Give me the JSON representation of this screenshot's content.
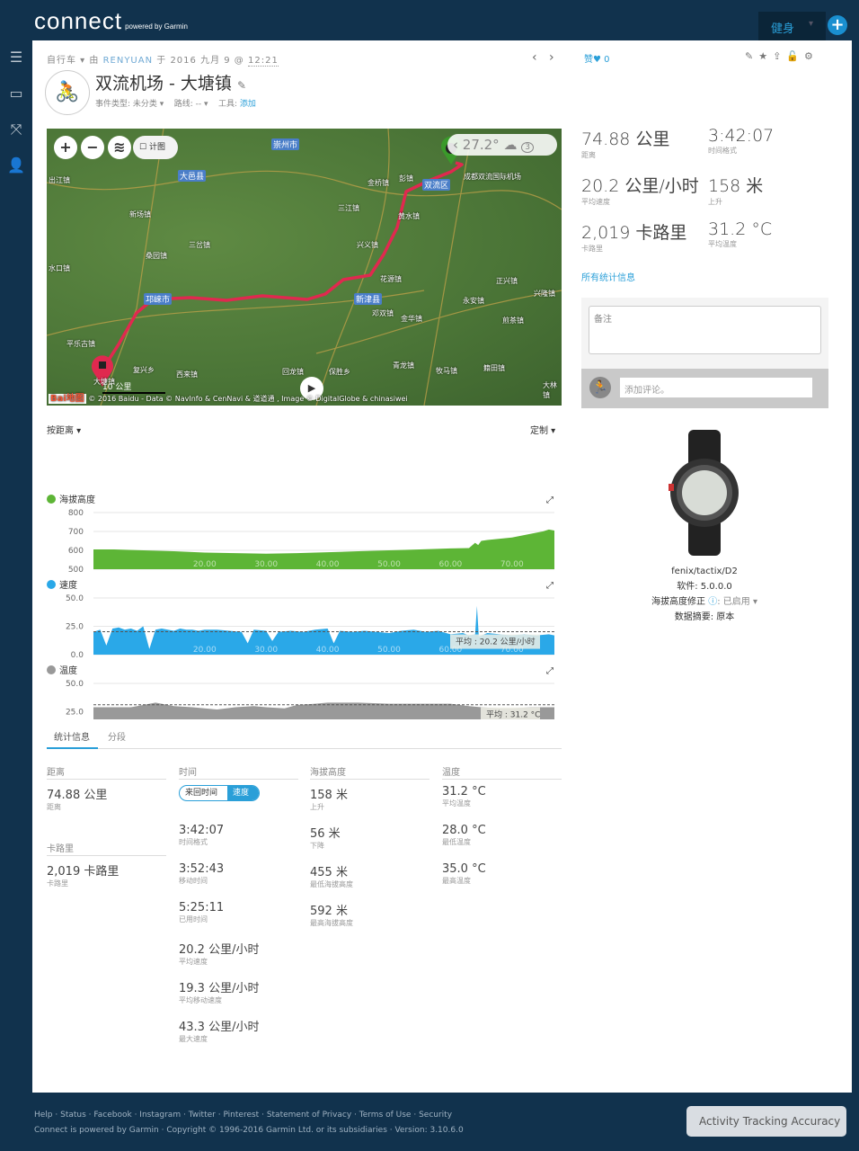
{
  "header": {
    "logo": "connect",
    "logo_sub": "powered by Garmin",
    "fitness_label": "健身",
    "menu_caret": "▾",
    "add_label": "+"
  },
  "sidebar": {
    "items": [
      {
        "icon": "menu-icon",
        "glyph": "☰"
      },
      {
        "icon": "inbox-icon",
        "glyph": "▭"
      },
      {
        "icon": "connections-icon",
        "glyph": "⤧"
      },
      {
        "icon": "user-icon",
        "glyph": "👤"
      }
    ]
  },
  "activity": {
    "type": "自行车",
    "by": "由",
    "user": "RENYUAN",
    "at": "于 2016 九月 9 @",
    "time": "12:21",
    "title": "双流机场 - 大塘镇",
    "event_type": "事件类型: 未分类 ▾",
    "route": "路线: -- ▾",
    "gear_label": "工具:",
    "gear_link": "添加",
    "like_label": "赞",
    "like_count": "0",
    "prev": "‹",
    "next": "›"
  },
  "map": {
    "zoom_in": "+",
    "zoom_out": "−",
    "layers": "≋",
    "checkbox_label": "计图",
    "weather_temp": "27.2°",
    "weather_badge": "3",
    "scale": "10 公里",
    "attribution": "© 2016 Baidu - Data © NavInfo & CenNavi & 道道通 , Image © DigitalGlobe & chinasiwei",
    "provider": "Bai地图",
    "cities": [
      "崇州市",
      "大邑县",
      "邛崃市",
      "新津县",
      "双流区"
    ],
    "towns": [
      "出江镇",
      "新场镇",
      "三岔镇",
      "桑园镇",
      "水口镇",
      "平乐古镇",
      "大塘镇",
      "复兴乡",
      "西来镇",
      "回龙镇",
      "保胜乡",
      "青龙镇",
      "牧马镇",
      "金桥镇",
      "彭镇",
      "三江镇",
      "黄水镇",
      "兴义镇",
      "花源镇",
      "邓双镇",
      "金华镇",
      "永安镇",
      "正兴镇",
      "兴隆镇",
      "煎茶镇",
      "籍田镇",
      "大林镇",
      "成都双流国际机场"
    ]
  },
  "summary": [
    {
      "value": "74.88 公里",
      "label": "距离"
    },
    {
      "value": "3:42:07",
      "label": "时间格式"
    },
    {
      "value": "20.2 公里/小时",
      "label": "平均速度"
    },
    {
      "value": "158 米",
      "label": "上升"
    },
    {
      "value": "2,019 卡路里",
      "label": "卡路里"
    },
    {
      "value": "31.2 °C",
      "label": "平均温度"
    }
  ],
  "all_stats_link": "所有统计信息",
  "notes": {
    "placeholder": "备注",
    "comment_placeholder": "添加评论。"
  },
  "device": {
    "name": "fenix/tactix/D2",
    "software": "软件: 5.0.0.0",
    "elev_corr_label": "海拔高度修正",
    "elev_corr_value": ": 已启用 ▾",
    "data_summary": "数据摘要: 原本"
  },
  "charts": {
    "x_mode": "按距离 ▾",
    "customize": "定制 ▾"
  },
  "chart_data": [
    {
      "type": "area",
      "name": "海拔高度",
      "color": "#5db536",
      "ylim": [
        500,
        800
      ],
      "yticks": [
        "800",
        "700",
        "600",
        "500"
      ],
      "xlim": [
        1.9,
        76.9
      ],
      "xticks": [
        "20.00",
        "30.00",
        "40.00",
        "50.00",
        "60.00",
        "70.00"
      ],
      "grid": true,
      "x": [
        1.9,
        5,
        10,
        15,
        20,
        25,
        30,
        35,
        40,
        45,
        50,
        55,
        60,
        63,
        64,
        64.5,
        65,
        66,
        70,
        75,
        76,
        76.9
      ],
      "y": [
        605,
        605,
        600,
        595,
        588,
        585,
        582,
        585,
        590,
        595,
        600,
        605,
        610,
        612,
        640,
        628,
        650,
        655,
        668,
        700,
        710,
        705
      ]
    },
    {
      "type": "area",
      "name": "速度",
      "color": "#2aa8e8",
      "ylim": [
        0,
        50
      ],
      "yticks": [
        "50.0",
        "25.0",
        "0.0"
      ],
      "xlim": [
        1.9,
        76.9
      ],
      "xticks": [
        "20.00",
        "30.00",
        "40.00",
        "50.00",
        "60.00",
        "70.00"
      ],
      "grid": true,
      "average": 20.2,
      "average_label": "平均 : 20.2 公里/小时",
      "x": [
        1.9,
        3,
        4,
        5,
        6,
        7,
        8,
        9,
        10,
        11,
        12,
        13,
        14,
        15,
        16,
        17,
        18,
        19,
        20,
        22,
        24,
        26,
        27,
        28,
        30,
        31,
        32,
        34,
        36,
        38,
        40,
        41,
        42,
        44,
        46,
        48,
        50,
        52,
        54,
        56,
        58,
        60,
        62,
        63,
        64,
        64.3,
        64.6,
        66,
        68,
        70,
        72,
        74,
        76,
        76.9
      ],
      "y": [
        20,
        22,
        8,
        23,
        24,
        22,
        23,
        21,
        25,
        5,
        22,
        23,
        22,
        21,
        23,
        22,
        22,
        21,
        22,
        22,
        21,
        20,
        10,
        22,
        21,
        12,
        20,
        21,
        20,
        22,
        23,
        10,
        21,
        20,
        21,
        20,
        19,
        21,
        22,
        20,
        21,
        18,
        19,
        17,
        18,
        43,
        16,
        19,
        18,
        17,
        18,
        17,
        18,
        17
      ]
    },
    {
      "type": "area",
      "name": "温度",
      "color": "#999999",
      "ylim": [
        0,
        50
      ],
      "yticks": [
        "50.0",
        "25.0",
        "0.0"
      ],
      "xlim": [
        1.9,
        76.9
      ],
      "xticks": [
        "20.00",
        "30.00",
        "40.00",
        "50.00",
        "60.00",
        "70.00"
      ],
      "grid": true,
      "average": 31.2,
      "average_label": "平均 : 31.2 °C",
      "x": [
        1.9,
        5,
        8,
        10,
        12,
        15,
        18,
        20,
        22,
        25,
        28,
        30,
        33,
        35,
        38,
        40,
        45,
        50,
        55,
        60,
        63,
        65,
        68,
        70,
        73,
        76.9
      ],
      "y": [
        29,
        29,
        29,
        31,
        33,
        30,
        29,
        28,
        27,
        29,
        30,
        29,
        28,
        31,
        32,
        33,
        33,
        32,
        32,
        32,
        30,
        29,
        28,
        28,
        29,
        29
      ]
    }
  ],
  "tabs": [
    {
      "label": "统计信息",
      "active": true
    },
    {
      "label": "分段",
      "active": false
    }
  ],
  "stats": {
    "distance": {
      "header": "距离",
      "items": [
        {
          "value": "74.88 公里",
          "label": "距离"
        }
      ]
    },
    "calories": {
      "header": "卡路里",
      "items": [
        {
          "value": "2,019 卡路里",
          "label": "卡路里"
        }
      ]
    },
    "time": {
      "header": "时间",
      "toggle": [
        "来回时间",
        "速度"
      ],
      "items": [
        {
          "value": "3:42:07",
          "label": "时间格式"
        },
        {
          "value": "3:52:43",
          "label": "移动时间"
        },
        {
          "value": "5:25:11",
          "label": "已用时间"
        },
        {
          "value": "20.2 公里/小时",
          "label": "平均速度"
        },
        {
          "value": "19.3 公里/小时",
          "label": "平均移动速度"
        },
        {
          "value": "43.3 公里/小时",
          "label": "最大速度"
        }
      ]
    },
    "elevation": {
      "header": "海拔高度",
      "items": [
        {
          "value": "158 米",
          "label": "上升"
        },
        {
          "value": "56 米",
          "label": "下降"
        },
        {
          "value": "455 米",
          "label": "最低海拔高度"
        },
        {
          "value": "592 米",
          "label": "最高海拔高度"
        }
      ]
    },
    "temperature": {
      "header": "温度",
      "items": [
        {
          "value": "31.2 °C",
          "label": "平均温度"
        },
        {
          "value": "28.0 °C",
          "label": "最低温度"
        },
        {
          "value": "35.0 °C",
          "label": "最高温度"
        }
      ]
    }
  },
  "footer": {
    "links": [
      "Help",
      "Status",
      "Facebook",
      "Instagram",
      "Twitter",
      "Pinterest",
      "Statement of Privacy",
      "Terms of Use",
      "Security"
    ],
    "copyright": "Connect is powered by Garmin · Copyright © 1996-2016 Garmin Ltd. or its subsidiaries · Version: 3.10.6.0"
  },
  "activity_tracking_button": "Activity Tracking Accuracy"
}
